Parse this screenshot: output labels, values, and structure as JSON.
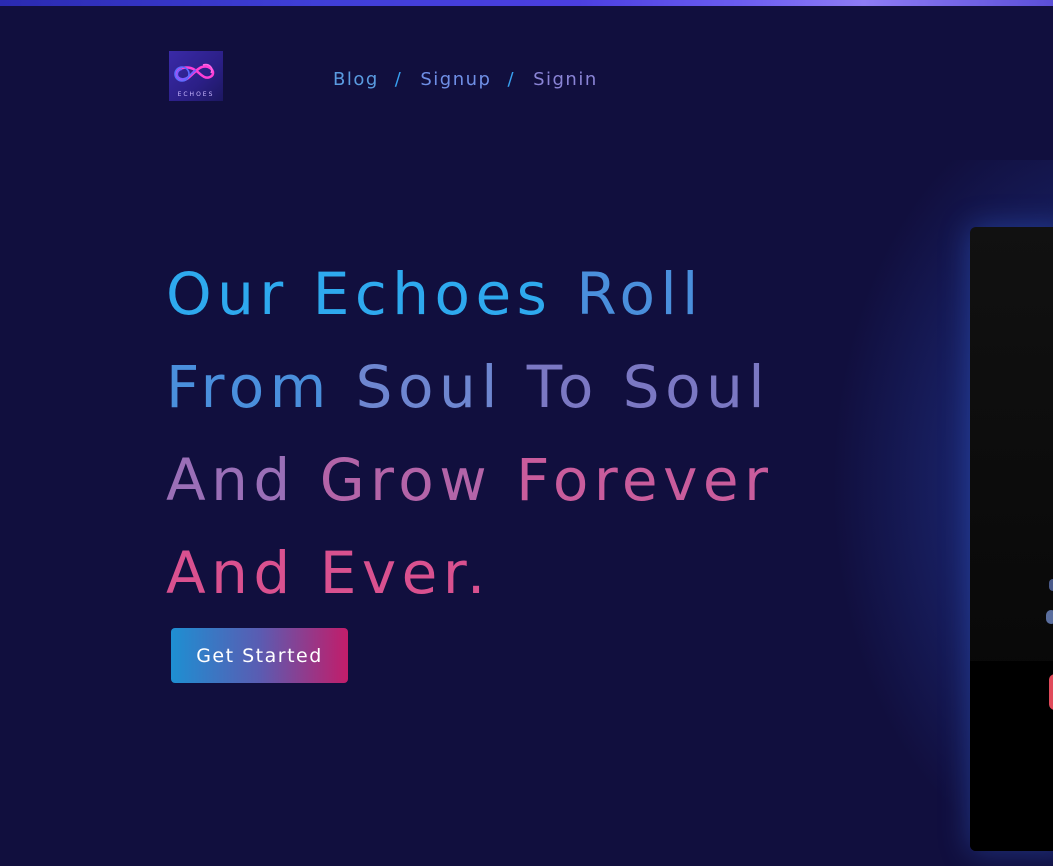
{
  "nav": {
    "items": [
      {
        "label": "Blog"
      },
      {
        "label": "Signup"
      },
      {
        "label": "Signin"
      }
    ],
    "separator": "/"
  },
  "logo": {
    "text": "ECHOES",
    "icon": "infinity-icon"
  },
  "hero": {
    "line1": {
      "w1": "Our",
      "w2": "Echoes",
      "w3": "Roll"
    },
    "line2": {
      "w1": "From",
      "w2": "Soul",
      "w3": "To",
      "w4": "Soul"
    },
    "line3": {
      "w1": "And",
      "w2": "Grow",
      "w3": "Forever"
    },
    "line4": {
      "w1": "And",
      "w2": "Ever."
    }
  },
  "cta": {
    "label": "Get Started"
  },
  "colors": {
    "background": "#110f3e",
    "gradient_start": "#2ea9ee",
    "gradient_end": "#d9518f",
    "button_start": "#1e8fd2",
    "button_end": "#c21d6a"
  }
}
